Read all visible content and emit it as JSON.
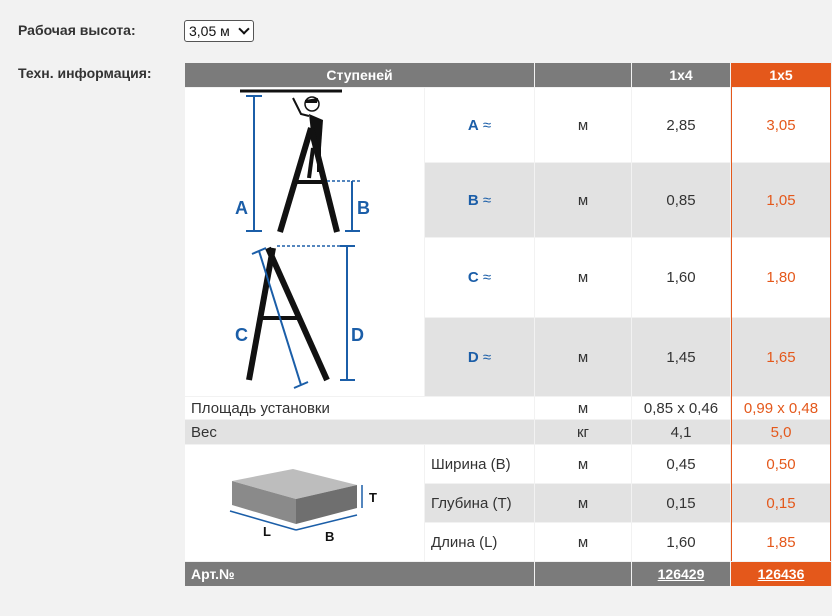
{
  "working_height": {
    "label": "Рабочая высота:",
    "selected": "3,05 м"
  },
  "tech_info_label": "Техн. информация:",
  "table": {
    "header": {
      "steps": "Ступеней",
      "col1": "1x4",
      "col2": "1x5"
    },
    "dim_rows": [
      {
        "name": "A",
        "unit": "м",
        "v1": "2,85",
        "v2": "3,05"
      },
      {
        "name": "B",
        "unit": "м",
        "v1": "0,85",
        "v2": "1,05"
      },
      {
        "name": "C",
        "unit": "м",
        "v1": "1,60",
        "v2": "1,80"
      },
      {
        "name": "D",
        "unit": "м",
        "v1": "1,45",
        "v2": "1,65"
      }
    ],
    "approx": "≈",
    "area": {
      "label": "Площадь установки",
      "unit": "м",
      "v1": "0,85 x 0,46",
      "v2": "0,99 x 0,48"
    },
    "weight": {
      "label": "Вес",
      "unit": "кг",
      "v1": "4,1",
      "v2": "5,0"
    },
    "pack_rows": [
      {
        "label": "Ширина (B)",
        "unit": "м",
        "v1": "0,45",
        "v2": "0,50"
      },
      {
        "label": "Глубина (T)",
        "unit": "м",
        "v1": "0,15",
        "v2": "0,15"
      },
      {
        "label": "Длина (L)",
        "unit": "м",
        "v1": "1,60",
        "v2": "1,85"
      }
    ],
    "art": {
      "label": "Арт.№",
      "v1": "126429",
      "v2": "126436"
    }
  },
  "diagram_labels": {
    "a": "A",
    "b": "B",
    "c": "C",
    "d": "D",
    "box_t": "T",
    "box_l": "L",
    "box_b": "B"
  },
  "colors": {
    "accent": "#e4581b",
    "header": "#7b7b7b",
    "dim_label": "#1b5ea8"
  }
}
